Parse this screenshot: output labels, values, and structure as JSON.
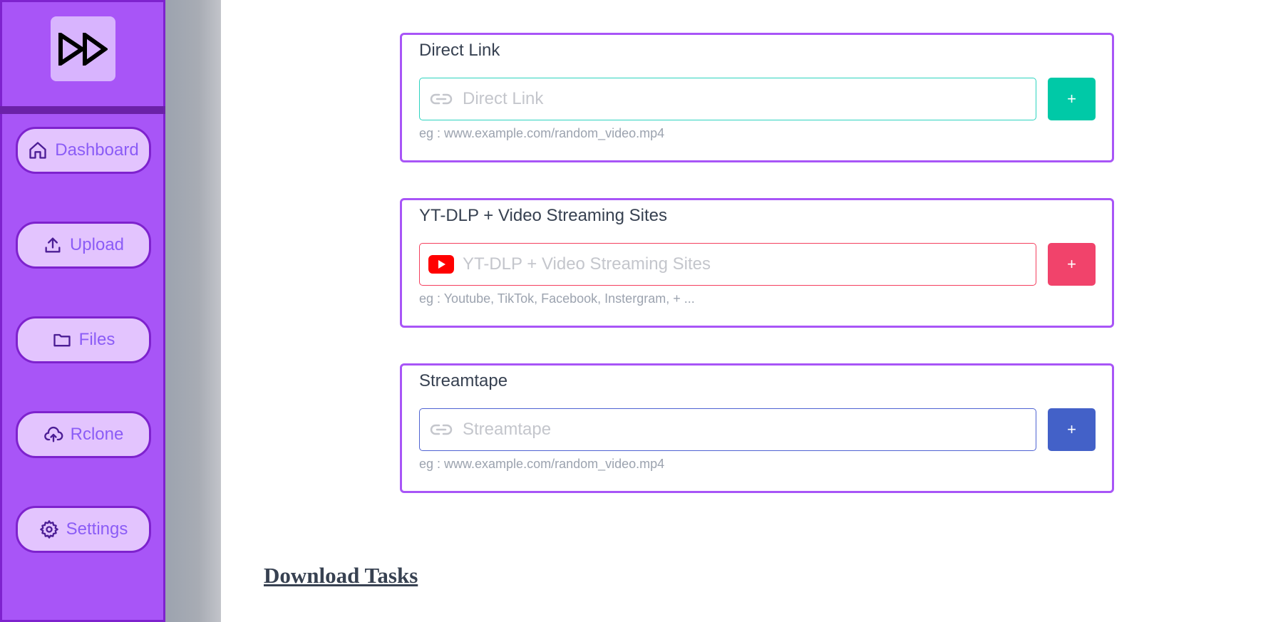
{
  "sidebar": {
    "logo_icon": "fast-forward-icon",
    "items": [
      {
        "label": "Dashboard",
        "icon": "home-icon"
      },
      {
        "label": "Upload",
        "icon": "upload-icon"
      },
      {
        "label": "Files",
        "icon": "folder-icon"
      },
      {
        "label": "Rclone",
        "icon": "cloud-upload-icon"
      },
      {
        "label": "Settings",
        "icon": "gear-icon"
      }
    ]
  },
  "cards": [
    {
      "title": "Direct Link",
      "placeholder": "Direct Link",
      "value": "",
      "icon": "link-icon",
      "button_label": "+",
      "hint": "eg : www.example.com/random_video.mp4",
      "accent": "#00c9a7"
    },
    {
      "title": "YT-DLP + Video Streaming Sites",
      "placeholder": "YT-DLP + Video Streaming Sites",
      "value": "",
      "icon": "youtube-icon",
      "button_label": "+",
      "hint": "eg : Youtube, TikTok, Facebook, Instergram, + ...",
      "accent": "#f1436b"
    },
    {
      "title": "Streamtape",
      "placeholder": "Streamtape",
      "value": "",
      "icon": "link-icon",
      "button_label": "+",
      "hint": "eg : www.example.com/random_video.mp4",
      "accent": "#4361c8"
    }
  ],
  "tasks": {
    "title": "Download Tasks"
  },
  "colors": {
    "sidebar_bg": "#a855f7",
    "sidebar_border": "#7e22ce",
    "nav_item_bg": "#e3c4fe",
    "nav_text": "#8b5cf6",
    "card_border": "#a855f7"
  }
}
